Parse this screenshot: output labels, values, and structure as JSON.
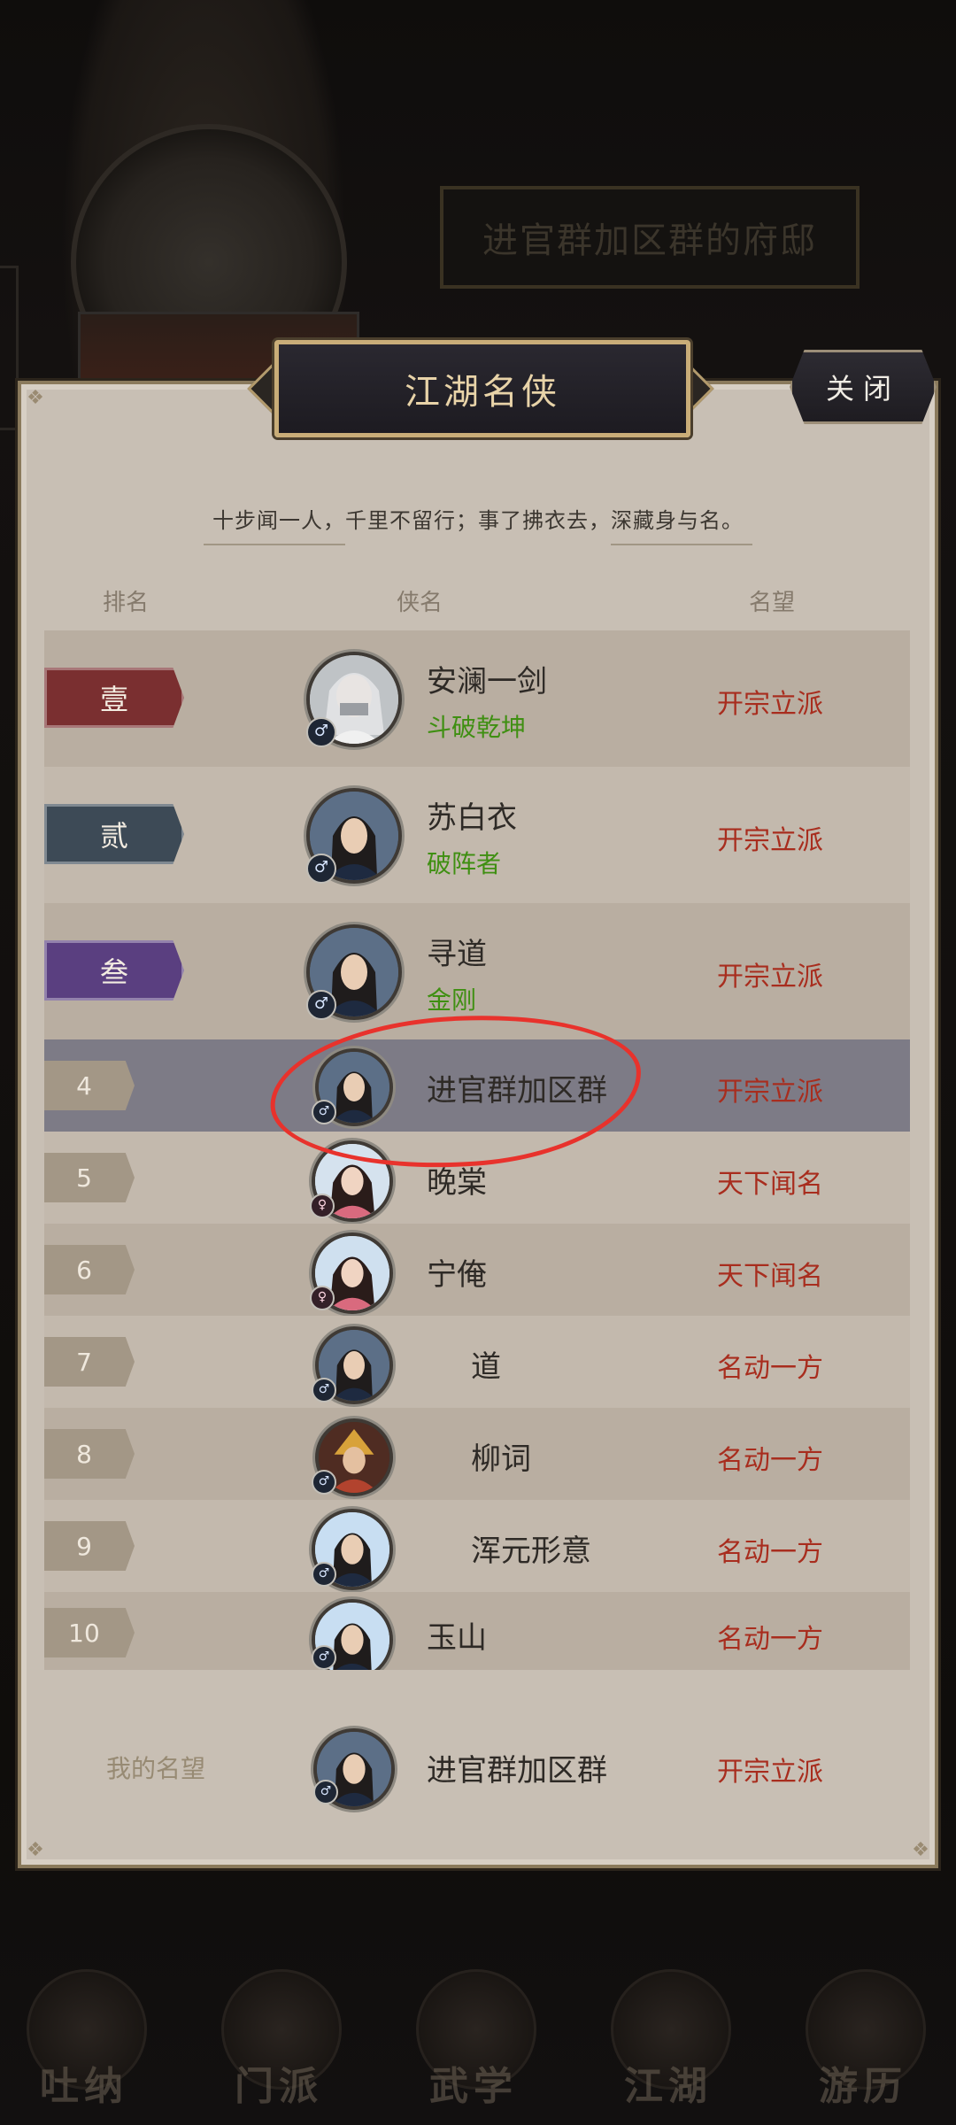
{
  "background": {
    "title": "进官群加区群的府邸",
    "nav": [
      "吐纳",
      "门派",
      "武学",
      "江湖",
      "游历"
    ]
  },
  "panel": {
    "title": "江湖名侠",
    "close_label": "关闭",
    "motto": "十步闻一人，千里不留行；事了拂衣去，深藏身与名。",
    "headers": {
      "rank": "排名",
      "name": "侠名",
      "fame": "名望"
    }
  },
  "ranking": [
    {
      "rank": "壹",
      "name": "安澜一剑",
      "title": "斗破乾坤",
      "fame": "开宗立派",
      "gender": "male"
    },
    {
      "rank": "贰",
      "name": "苏白衣",
      "title": "破阵者",
      "fame": "开宗立派",
      "gender": "male"
    },
    {
      "rank": "叁",
      "name": "寻道",
      "title": "金刚",
      "fame": "开宗立派",
      "gender": "male"
    },
    {
      "rank": "4",
      "name": "进官群加区群",
      "title": "",
      "fame": "开宗立派",
      "gender": "male"
    },
    {
      "rank": "5",
      "name": "晚棠",
      "title": "",
      "fame": "天下闻名",
      "gender": "female"
    },
    {
      "rank": "6",
      "name": "宁俺",
      "title": "",
      "fame": "天下闻名",
      "gender": "female"
    },
    {
      "rank": "7",
      "name": "道",
      "title": "",
      "fame": "名动一方",
      "gender": "male"
    },
    {
      "rank": "8",
      "name": "柳词",
      "title": "",
      "fame": "名动一方",
      "gender": "male"
    },
    {
      "rank": "9",
      "name": "浑元形意",
      "title": "",
      "fame": "名动一方",
      "gender": "male"
    },
    {
      "rank": "10",
      "name": "玉山",
      "title": "",
      "fame": "名动一方",
      "gender": "male"
    }
  ],
  "my_fame": {
    "label": "我的名望",
    "name": "进官群加区群",
    "fame": "开宗立派"
  },
  "icons": {
    "male": "♂",
    "female": "♀"
  },
  "colors": {
    "rank1": "#7a2f30",
    "rank2": "#3d4a56",
    "rank3": "#5a3f80",
    "fame": "#a82d1e",
    "title_green": "#3f8f12",
    "highlight_row": "#7d7b86",
    "annotation": "#e8322c"
  }
}
